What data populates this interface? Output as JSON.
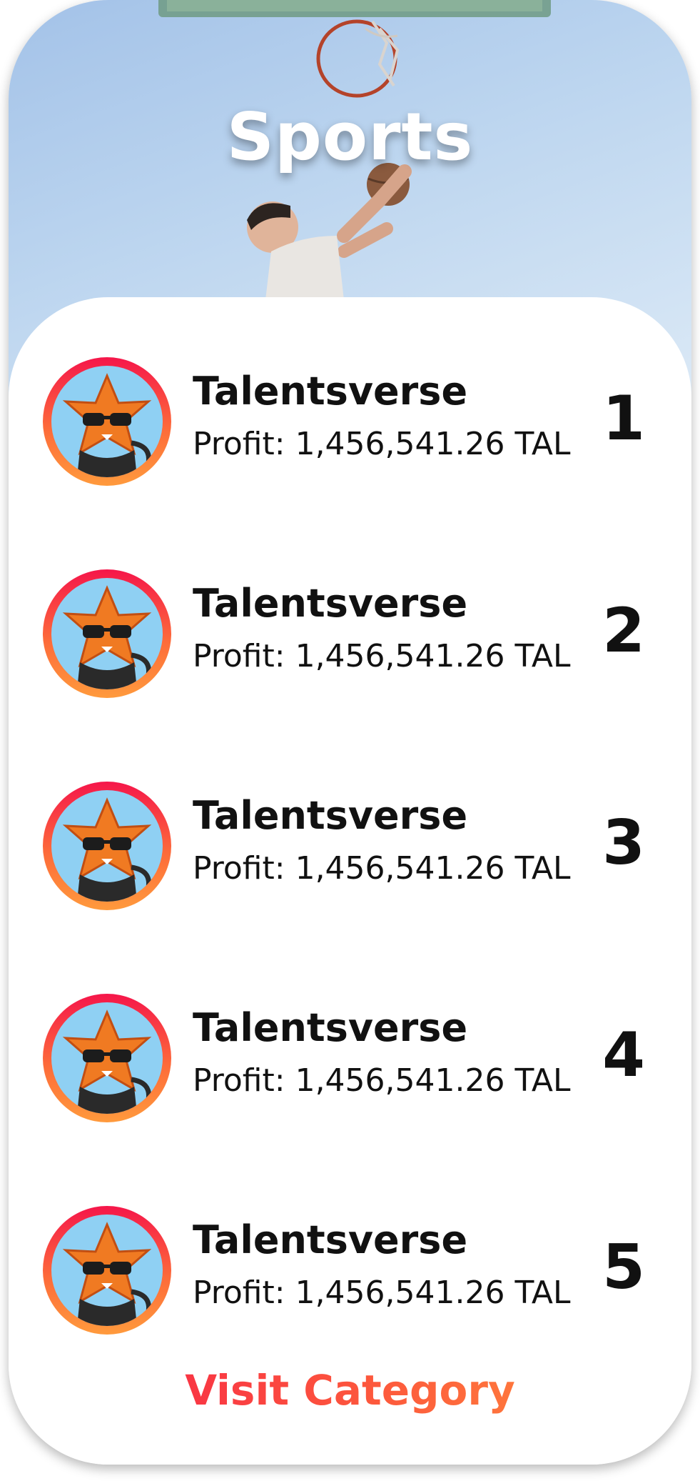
{
  "category": {
    "title": "Sports"
  },
  "leaderboard": [
    {
      "name": "Talentsverse",
      "profit": "Profit: 1,456,541.26 TAL",
      "rank": "1"
    },
    {
      "name": "Talentsverse",
      "profit": "Profit: 1,456,541.26 TAL",
      "rank": "2"
    },
    {
      "name": "Talentsverse",
      "profit": "Profit: 1,456,541.26 TAL",
      "rank": "3"
    },
    {
      "name": "Talentsverse",
      "profit": "Profit: 1,456,541.26 TAL",
      "rank": "4"
    },
    {
      "name": "Talentsverse",
      "profit": "Profit: 1,456,541.26 TAL",
      "rank": "5"
    }
  ],
  "actions": {
    "visit_label": "Visit Category"
  },
  "colors": {
    "accent_start": "#f5164a",
    "accent_end": "#ff9a3c",
    "avatar_background": "#8fd0f3",
    "hero_sky": "#bcd5ef"
  },
  "icons": {
    "avatar": "fox-mascot-avatar",
    "hero": "basketball-hoop-player-photo"
  }
}
